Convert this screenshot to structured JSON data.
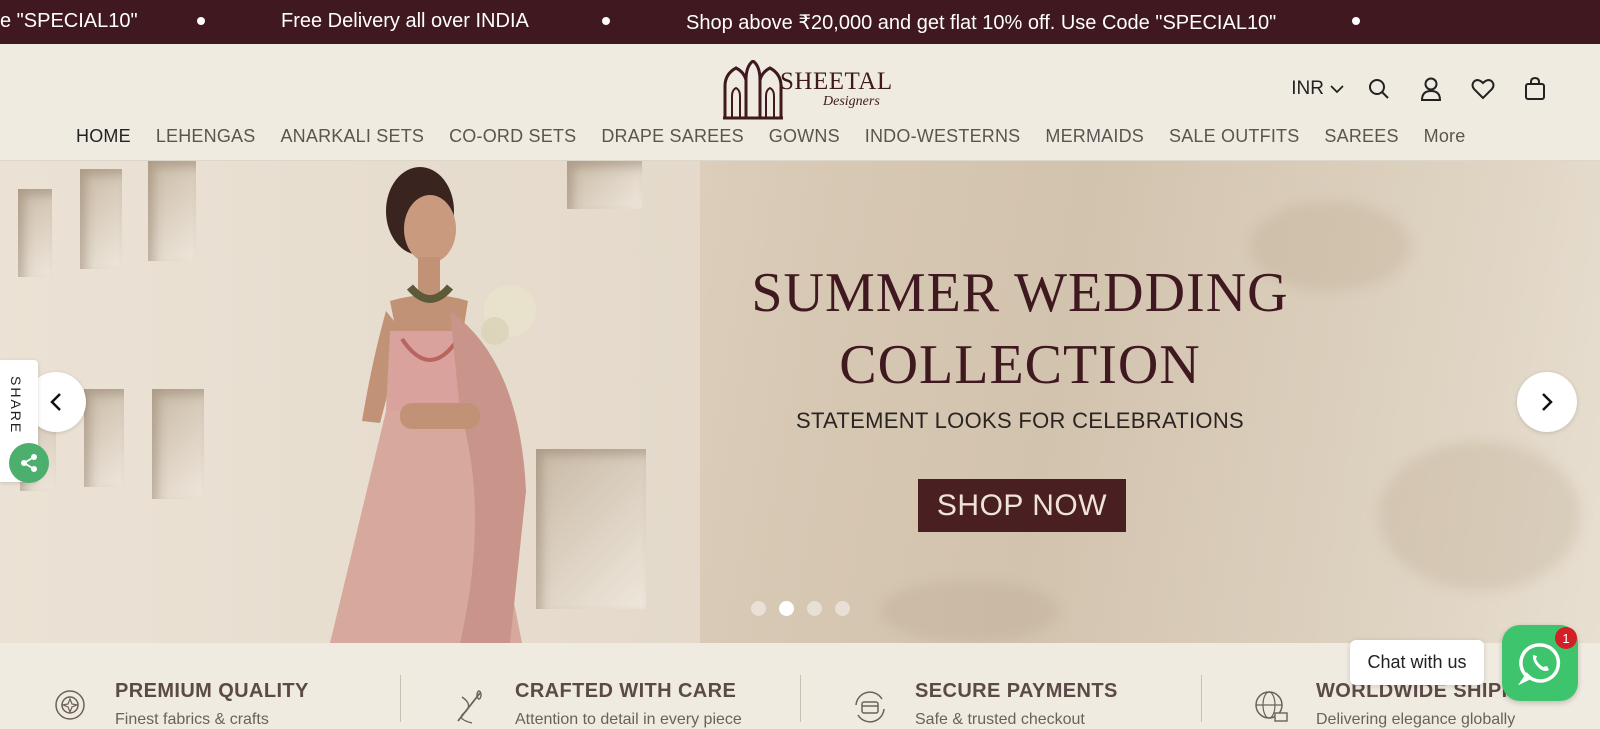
{
  "announcement": {
    "items": [
      "e \"SPECIAL10\"",
      "Free Delivery all over INDIA",
      "Shop above ₹20,000 and get flat 10% off. Use Code \"SPECIAL10\""
    ]
  },
  "logo": {
    "brand": "SHEETAL",
    "sub": "Designers"
  },
  "header": {
    "currency": "INR",
    "icons": [
      "search-icon",
      "account-icon",
      "wishlist-icon",
      "cart-icon"
    ]
  },
  "nav": {
    "items": [
      {
        "label": "HOME",
        "active": true
      },
      {
        "label": "LEHENGAS"
      },
      {
        "label": "ANARKALI SETS"
      },
      {
        "label": "CO-ORD SETS"
      },
      {
        "label": "DRAPE SAREES"
      },
      {
        "label": "GOWNS"
      },
      {
        "label": "INDO-WESTERNS"
      },
      {
        "label": "MERMAIDS"
      },
      {
        "label": "SALE OUTFITS"
      },
      {
        "label": "SAREES"
      },
      {
        "label": "More"
      }
    ]
  },
  "hero": {
    "title_line1": "SUMMER WEDDING",
    "title_line2": "COLLECTION",
    "subtitle": "STATEMENT LOOKS FOR CELEBRATIONS",
    "cta": "SHOP NOW",
    "slide_count": 4,
    "active_slide": 2
  },
  "share": {
    "label": "SHARE"
  },
  "features": [
    {
      "title": "PREMIUM QUALITY",
      "subtitle": "Finest fabrics & crafts",
      "icon": "badge-icon"
    },
    {
      "title": "CRAFTED WITH CARE",
      "subtitle": "Attention to detail in every piece",
      "icon": "needle-thread-icon"
    },
    {
      "title": "SECURE PAYMENTS",
      "subtitle": "Safe & trusted checkout",
      "icon": "secure-payment-icon"
    },
    {
      "title": "WORLDWIDE SHIPPING",
      "subtitle": "Delivering elegance globally",
      "icon": "globe-shipping-icon"
    }
  ],
  "chat": {
    "label": "Chat with us",
    "badge": "1"
  },
  "colors": {
    "brand": "#3f1820",
    "cta": "#4a1f22",
    "whatsapp": "#3ec46d"
  }
}
